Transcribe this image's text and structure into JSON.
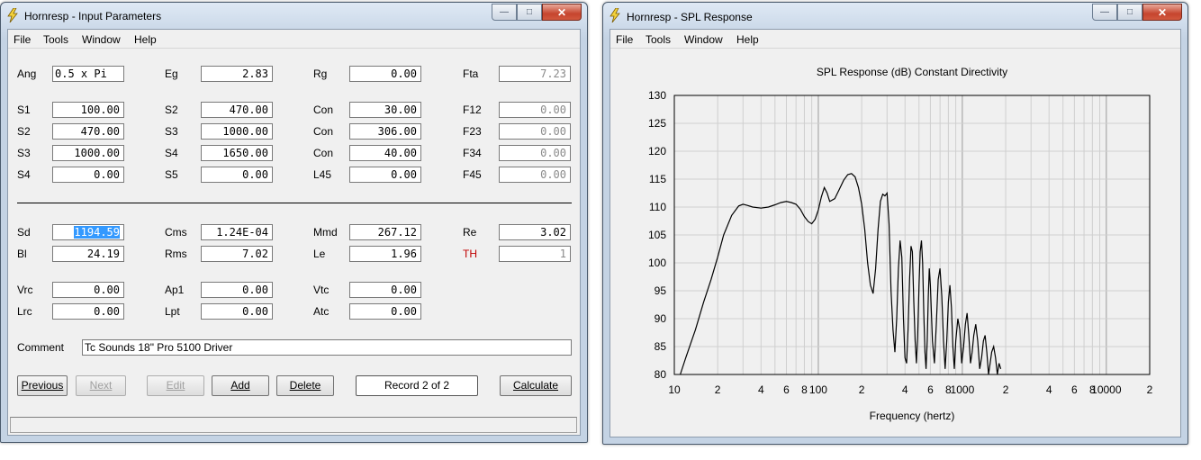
{
  "left_window": {
    "title": "Hornresp - Input Parameters",
    "menu": [
      "File",
      "Tools",
      "Window",
      "Help"
    ],
    "fields": {
      "ang": {
        "label": "Ang",
        "value": "0.5 x Pi"
      },
      "eg": {
        "label": "Eg",
        "value": "2.83"
      },
      "rg": {
        "label": "Rg",
        "value": "0.00"
      },
      "fta": {
        "label": "Fta",
        "value": "7.23"
      },
      "s1": {
        "label": "S1",
        "value": "100.00"
      },
      "s2a": {
        "label": "S2",
        "value": "470.00"
      },
      "con1": {
        "label": "Con",
        "value": "30.00"
      },
      "f12": {
        "label": "F12",
        "value": "0.00"
      },
      "s2b": {
        "label": "S2",
        "value": "470.00"
      },
      "s3a": {
        "label": "S3",
        "value": "1000.00"
      },
      "con2": {
        "label": "Con",
        "value": "306.00"
      },
      "f23": {
        "label": "F23",
        "value": "0.00"
      },
      "s3b": {
        "label": "S3",
        "value": "1000.00"
      },
      "s4a": {
        "label": "S4",
        "value": "1650.00"
      },
      "con3": {
        "label": "Con",
        "value": "40.00"
      },
      "f34": {
        "label": "F34",
        "value": "0.00"
      },
      "s4b": {
        "label": "S4",
        "value": "0.00"
      },
      "s5": {
        "label": "S5",
        "value": "0.00"
      },
      "l45": {
        "label": "L45",
        "value": "0.00"
      },
      "f45": {
        "label": "F45",
        "value": "0.00"
      },
      "sd": {
        "label": "Sd",
        "value": "1194.59"
      },
      "cms": {
        "label": "Cms",
        "value": "1.24E-04"
      },
      "mmd": {
        "label": "Mmd",
        "value": "267.12"
      },
      "re": {
        "label": "Re",
        "value": "3.02"
      },
      "bl": {
        "label": "Bl",
        "value": "24.19"
      },
      "rms": {
        "label": "Rms",
        "value": "7.02"
      },
      "le": {
        "label": "Le",
        "value": "1.96"
      },
      "th": {
        "label": "TH",
        "value": "1"
      },
      "vrc": {
        "label": "Vrc",
        "value": "0.00"
      },
      "ap1": {
        "label": "Ap1",
        "value": "0.00"
      },
      "vtc": {
        "label": "Vtc",
        "value": "0.00"
      },
      "lrc": {
        "label": "Lrc",
        "value": "0.00"
      },
      "lpt": {
        "label": "Lpt",
        "value": "0.00"
      },
      "atc": {
        "label": "Atc",
        "value": "0.00"
      }
    },
    "comment": {
      "label": "Comment",
      "value": "Tc Sounds 18\" Pro 5100 Driver"
    },
    "buttons": {
      "previous": "Previous",
      "next": "Next",
      "edit": "Edit",
      "add": "Add",
      "delete": "Delete",
      "record": "Record 2 of 2",
      "calculate": "Calculate"
    }
  },
  "right_window": {
    "title": "Hornresp - SPL Response",
    "menu": [
      "File",
      "Tools",
      "Window",
      "Help"
    ]
  },
  "chart_data": {
    "type": "line",
    "title": "SPL Response (dB)   Constant Directivity",
    "xlabel": "Frequency (hertz)",
    "ylabel": "",
    "xscale": "log",
    "xlim": [
      10,
      20000
    ],
    "ylim": [
      80,
      130
    ],
    "yticks": [
      80,
      85,
      90,
      95,
      100,
      105,
      110,
      115,
      120,
      125,
      130
    ],
    "xtick_labels": [
      "10",
      "2",
      "4",
      "6",
      "8",
      "100",
      "2",
      "4",
      "6",
      "8",
      "1000",
      "2",
      "4",
      "6",
      "8",
      "10000",
      "2"
    ],
    "xtick_values": [
      10,
      20,
      40,
      60,
      80,
      100,
      200,
      400,
      600,
      800,
      1000,
      2000,
      4000,
      6000,
      8000,
      10000,
      20000
    ],
    "grid": true,
    "line_color": "#000000",
    "series": [
      {
        "x": [
          11,
          12,
          14,
          16,
          18,
          20,
          22,
          25,
          28,
          30,
          32,
          35,
          40,
          45,
          50,
          55,
          60,
          65,
          70,
          75,
          80,
          85,
          90,
          95,
          100,
          105,
          110,
          115,
          120,
          130,
          140,
          150,
          160,
          170,
          180,
          190,
          200,
          210,
          220,
          230,
          240,
          250,
          260,
          270,
          280,
          290,
          300,
          310,
          320,
          330,
          340,
          350,
          360,
          370,
          380,
          390,
          400,
          410,
          420,
          430,
          440,
          450,
          460,
          470,
          480,
          490,
          500,
          510,
          520,
          530,
          540,
          550,
          560,
          570,
          580,
          590,
          600,
          620,
          640,
          660,
          680,
          700,
          720,
          740,
          760,
          780,
          800,
          820,
          840,
          860,
          880,
          900,
          930,
          960,
          990,
          1020,
          1050,
          1080,
          1110,
          1140,
          1170,
          1200,
          1240,
          1280,
          1320,
          1360,
          1400,
          1440,
          1480,
          1520,
          1560,
          1600,
          1650,
          1700,
          1750,
          1800,
          1850
        ],
        "y": [
          80,
          83,
          88,
          93,
          97,
          101,
          105,
          108.5,
          110.2,
          110.5,
          110.3,
          110,
          109.8,
          110,
          110.4,
          110.8,
          111,
          110.8,
          110.5,
          109.6,
          108.3,
          107.4,
          107,
          107.8,
          109.5,
          111.8,
          113.5,
          112.5,
          111,
          111.5,
          113.2,
          114.8,
          115.8,
          116,
          115.4,
          113.5,
          110.5,
          106,
          100,
          96,
          94.5,
          99,
          106,
          111,
          112.3,
          112,
          112.5,
          107,
          95,
          88,
          84,
          90,
          99,
          104,
          101,
          90,
          83,
          82,
          88,
          97,
          103,
          102,
          93,
          86,
          82,
          87,
          96,
          102,
          104,
          100,
          91,
          84,
          81,
          86,
          94,
          99,
          96,
          86,
          82,
          89,
          97,
          99,
          94,
          86,
          81,
          86,
          93,
          96,
          92,
          85,
          81,
          86,
          90,
          88,
          82,
          85,
          89,
          91,
          87,
          82,
          84,
          87,
          89,
          86,
          81,
          83,
          86,
          87,
          84,
          80,
          82,
          84,
          85,
          83,
          80,
          82,
          81
        ]
      }
    ]
  }
}
